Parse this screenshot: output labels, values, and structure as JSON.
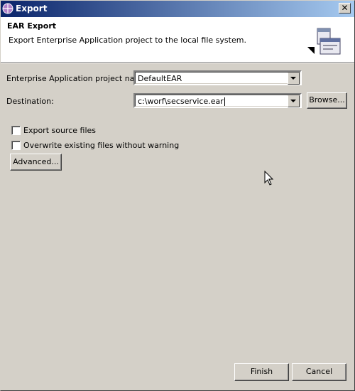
{
  "window": {
    "title": "Export",
    "close_glyph": "✕"
  },
  "banner": {
    "title": "EAR Export",
    "description": "Export Enterprise Application project to the local file system.",
    "icon": "export-wizard-icon"
  },
  "form": {
    "project_label": "Enterprise Application project name:",
    "project_value": "DefaultEAR",
    "destination_label": "Destination:",
    "destination_value": "c:\\worf\\secservice.ear",
    "browse_label": "Browse..."
  },
  "options": {
    "export_source_label": "Export source files",
    "export_source_checked": false,
    "overwrite_label": "Overwrite existing files without warning",
    "overwrite_checked": false,
    "advanced_label": "Advanced..."
  },
  "footer": {
    "finish_label": "Finish",
    "cancel_label": "Cancel"
  }
}
